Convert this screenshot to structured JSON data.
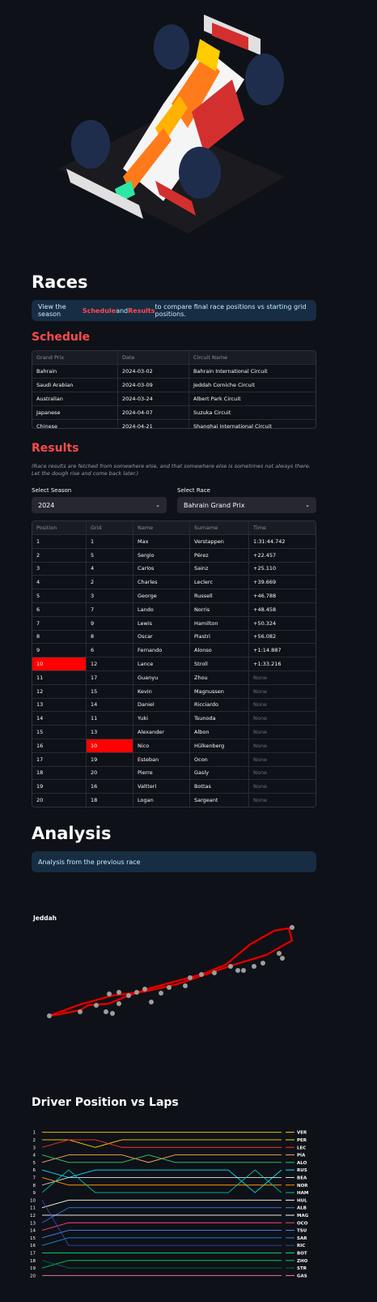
{
  "races": {
    "title": "Races",
    "info_pre": "View the season ",
    "info_schedule": "Schedule",
    "info_and": " and ",
    "info_results": "Results",
    "info_post": " to compare final race positions vs starting grid positions."
  },
  "schedule": {
    "title": "Schedule",
    "columns": [
      "Grand Prix",
      "Date",
      "Circuit Name"
    ],
    "rows": [
      [
        "Bahrain",
        "2024-03-02",
        "Bahrain International Circuit"
      ],
      [
        "Saudi Arabian",
        "2024-03-09",
        "Jeddah Corniche Circuit"
      ],
      [
        "Australian",
        "2024-03-24",
        "Albert Park Circuit"
      ],
      [
        "Japanese",
        "2024-04-07",
        "Suzuka Circuit"
      ],
      [
        "Chinese",
        "2024-04-21",
        "Shanghai International Circuit"
      ]
    ]
  },
  "results": {
    "title": "Results",
    "note": "(Race results are fetched from somewhere else, and that somewhere else is sometimes not always there. Let the dough rise and come back later.)",
    "season_label": "Select Season",
    "season_value": "2024",
    "race_label": "Select Race",
    "race_value": "Bahrain Grand Prix",
    "columns": [
      "Position",
      "Grid",
      "Name",
      "Surname",
      "Time"
    ],
    "rows": [
      [
        "1",
        "1",
        "Max",
        "Verstappen",
        "1:31:44.742"
      ],
      [
        "2",
        "5",
        "Sergio",
        "Pérez",
        "+22.457"
      ],
      [
        "3",
        "4",
        "Carlos",
        "Sainz",
        "+25.110"
      ],
      [
        "4",
        "2",
        "Charles",
        "Leclerc",
        "+39.669"
      ],
      [
        "5",
        "3",
        "George",
        "Russell",
        "+46.788"
      ],
      [
        "6",
        "7",
        "Lando",
        "Norris",
        "+48.458"
      ],
      [
        "7",
        "9",
        "Lewis",
        "Hamilton",
        "+50.324"
      ],
      [
        "8",
        "8",
        "Oscar",
        "Piastri",
        "+56.082"
      ],
      [
        "9",
        "6",
        "Fernando",
        "Alonso",
        "+1:14.887"
      ],
      [
        "10",
        "12",
        "Lance",
        "Stroll",
        "+1:33.216"
      ],
      [
        "11",
        "17",
        "Guanyu",
        "Zhou",
        "None"
      ],
      [
        "12",
        "15",
        "Kevin",
        "Magnussen",
        "None"
      ],
      [
        "13",
        "14",
        "Daniel",
        "Ricciardo",
        "None"
      ],
      [
        "14",
        "11",
        "Yuki",
        "Tsunoda",
        "None"
      ],
      [
        "15",
        "13",
        "Alexander",
        "Albon",
        "None"
      ],
      [
        "16",
        "10",
        "Nico",
        "Hülkenberg",
        "None"
      ],
      [
        "17",
        "19",
        "Esteban",
        "Ocon",
        "None"
      ],
      [
        "18",
        "20",
        "Pierre",
        "Gasly",
        "None"
      ],
      [
        "19",
        "16",
        "Valtteri",
        "Bottas",
        "None"
      ],
      [
        "20",
        "18",
        "Logan",
        "Sargeant",
        "None"
      ]
    ],
    "highlight_color": "#ff0000"
  },
  "analysis": {
    "title": "Analysis",
    "info": "Analysis from the previous race",
    "track_title": "Jeddah",
    "track_color": "#ff0000",
    "track_outline_color": "#8b0000",
    "corner_marker_color": "#9e9e9e"
  },
  "positions_chart": {
    "title": "Driver Position vs Laps"
  },
  "chart_data": {
    "type": "line",
    "title": "Driver Position vs Laps",
    "xlabel": "",
    "ylabel": "",
    "y_ticks": [
      1,
      2,
      3,
      4,
      5,
      6,
      7,
      8,
      9,
      10,
      11,
      12,
      13,
      14,
      15,
      16,
      17,
      18,
      19,
      20
    ],
    "y_inverted": true,
    "grid": false,
    "legend_placement": "right",
    "series": [
      {
        "name": "VER",
        "color": "#ffd400",
        "values": [
          1,
          1,
          1,
          1,
          1,
          1,
          1,
          1,
          1,
          1
        ]
      },
      {
        "name": "PER",
        "color": "#ffd400",
        "values": [
          2,
          2,
          3,
          2,
          2,
          2,
          2,
          2,
          2,
          2
        ]
      },
      {
        "name": "LEC",
        "color": "#ff3333",
        "values": [
          3,
          2,
          2,
          3,
          3,
          3,
          3,
          3,
          3,
          3
        ]
      },
      {
        "name": "PIA",
        "color": "#ffa64d",
        "values": [
          5,
          4,
          4,
          4,
          5,
          4,
          4,
          4,
          4,
          4
        ]
      },
      {
        "name": "ALO",
        "color": "#2ecc71",
        "values": [
          4,
          5,
          5,
          5,
          4,
          5,
          5,
          5,
          5,
          5
        ]
      },
      {
        "name": "RUS",
        "color": "#00e5ff",
        "values": [
          6,
          7,
          6,
          6,
          6,
          6,
          6,
          6,
          9,
          6
        ]
      },
      {
        "name": "BEA",
        "color": "#e0e0e0",
        "values": [
          8,
          7,
          7,
          7,
          7,
          7,
          7,
          7,
          7,
          7
        ]
      },
      {
        "name": "NOR",
        "color": "#ff9900",
        "values": [
          7,
          8,
          8,
          8,
          8,
          8,
          8,
          8,
          8,
          8
        ]
      },
      {
        "name": "HAM",
        "color": "#00bfa5",
        "values": [
          9,
          6,
          9,
          9,
          9,
          9,
          9,
          9,
          6,
          9
        ]
      },
      {
        "name": "HUL",
        "color": "#ffffff",
        "values": [
          11,
          10,
          10,
          10,
          10,
          10,
          10,
          10,
          10,
          10
        ]
      },
      {
        "name": "ALB",
        "color": "#2979ff",
        "values": [
          13,
          11,
          11,
          11,
          11,
          11,
          11,
          11,
          11,
          11
        ]
      },
      {
        "name": "MAG",
        "color": "#ffffff",
        "values": [
          12,
          12,
          12,
          12,
          12,
          12,
          12,
          12,
          12,
          12
        ]
      },
      {
        "name": "OCO",
        "color": "#ff4081",
        "values": [
          14,
          13,
          13,
          13,
          13,
          13,
          13,
          13,
          13,
          13
        ]
      },
      {
        "name": "TSU",
        "color": "#448aff",
        "values": [
          15,
          14,
          14,
          14,
          14,
          14,
          14,
          14,
          14,
          14
        ]
      },
      {
        "name": "SAR",
        "color": "#1e88e5",
        "values": [
          16,
          15,
          15,
          15,
          15,
          15,
          15,
          15,
          15,
          15
        ]
      },
      {
        "name": "RIC",
        "color": "#3949ab",
        "values": [
          10,
          16,
          16,
          16,
          16,
          16,
          16,
          16,
          16,
          16
        ]
      },
      {
        "name": "BOT",
        "color": "#00e676",
        "values": [
          17,
          17,
          17,
          17,
          17,
          17,
          17,
          17,
          17,
          17
        ]
      },
      {
        "name": "ZHO",
        "color": "#00c853",
        "values": [
          19,
          18,
          18,
          18,
          18,
          18,
          18,
          18,
          18,
          18
        ]
      },
      {
        "name": "STR",
        "color": "#00695c",
        "values": [
          18,
          19,
          19,
          19,
          19,
          19,
          19,
          19,
          19,
          19
        ]
      },
      {
        "name": "GAS",
        "color": "#ff80ab",
        "values": [
          20,
          20,
          20,
          20,
          20,
          20,
          20,
          20,
          20,
          20
        ]
      }
    ]
  }
}
